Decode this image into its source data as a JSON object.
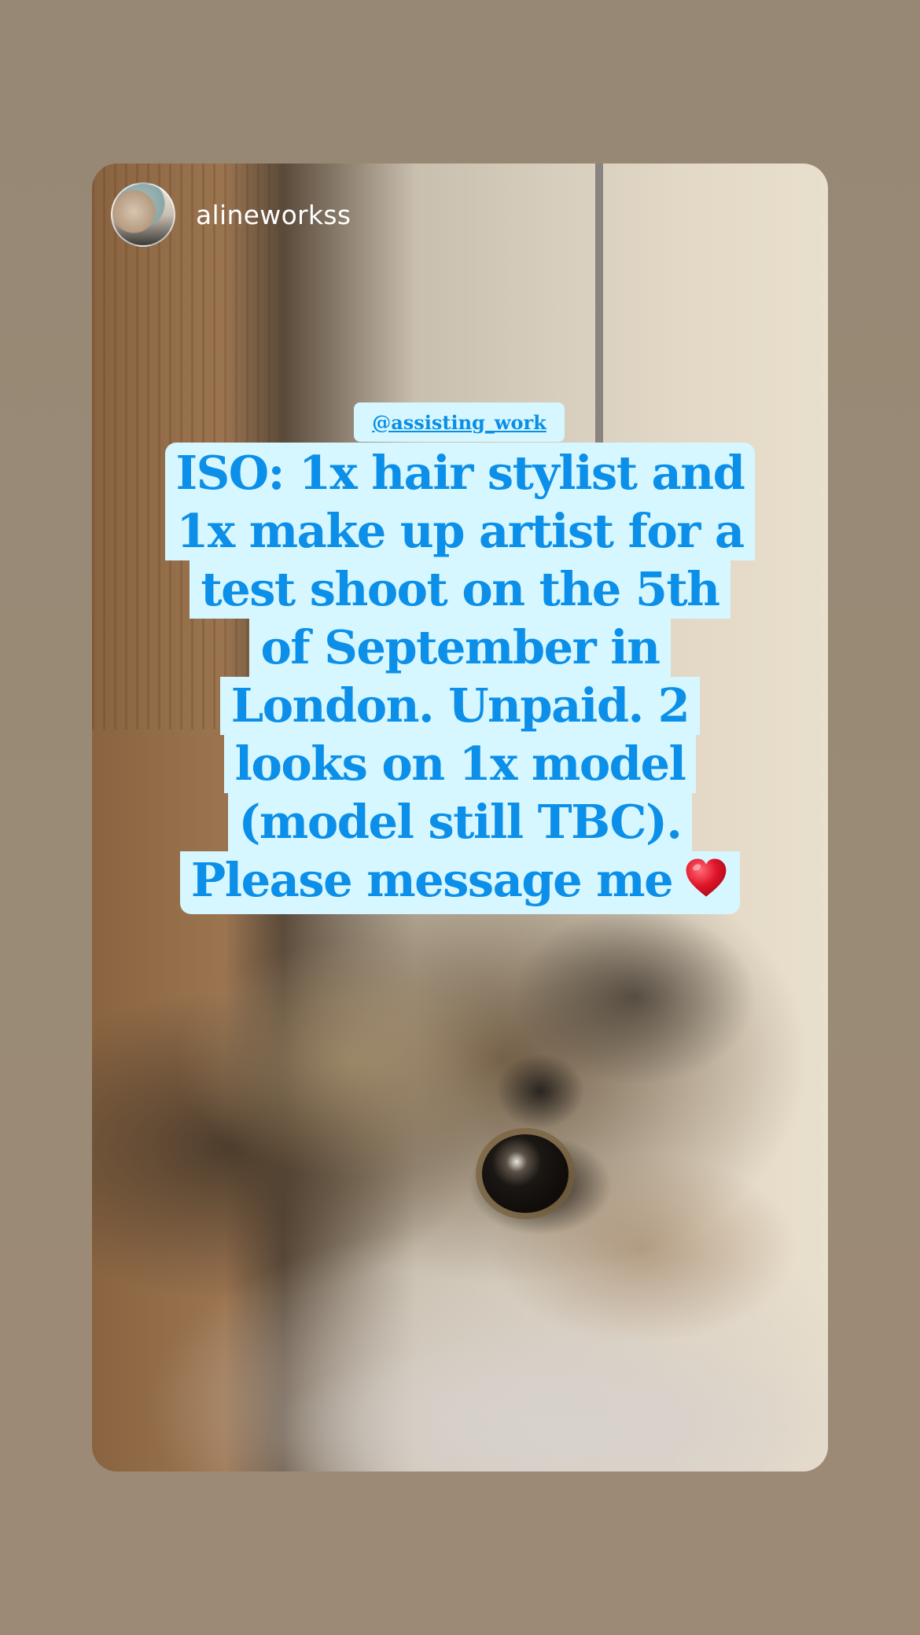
{
  "story": {
    "username": "alineworkss",
    "mention": "@assisting_work",
    "caption_lines": [
      "ISO: 1x hair stylist and",
      "1x make up artist for a",
      "test shoot on the 5th",
      "of September in",
      "London. Unpaid. 2",
      "looks on 1x model",
      "(model still TBC).",
      "Please message me"
    ],
    "emoji": "heart-icon"
  },
  "colors": {
    "page_background": "#998a76",
    "caption_background": "#d6f7ff",
    "caption_text": "#0c8fe8",
    "heart": "#e0152a"
  }
}
